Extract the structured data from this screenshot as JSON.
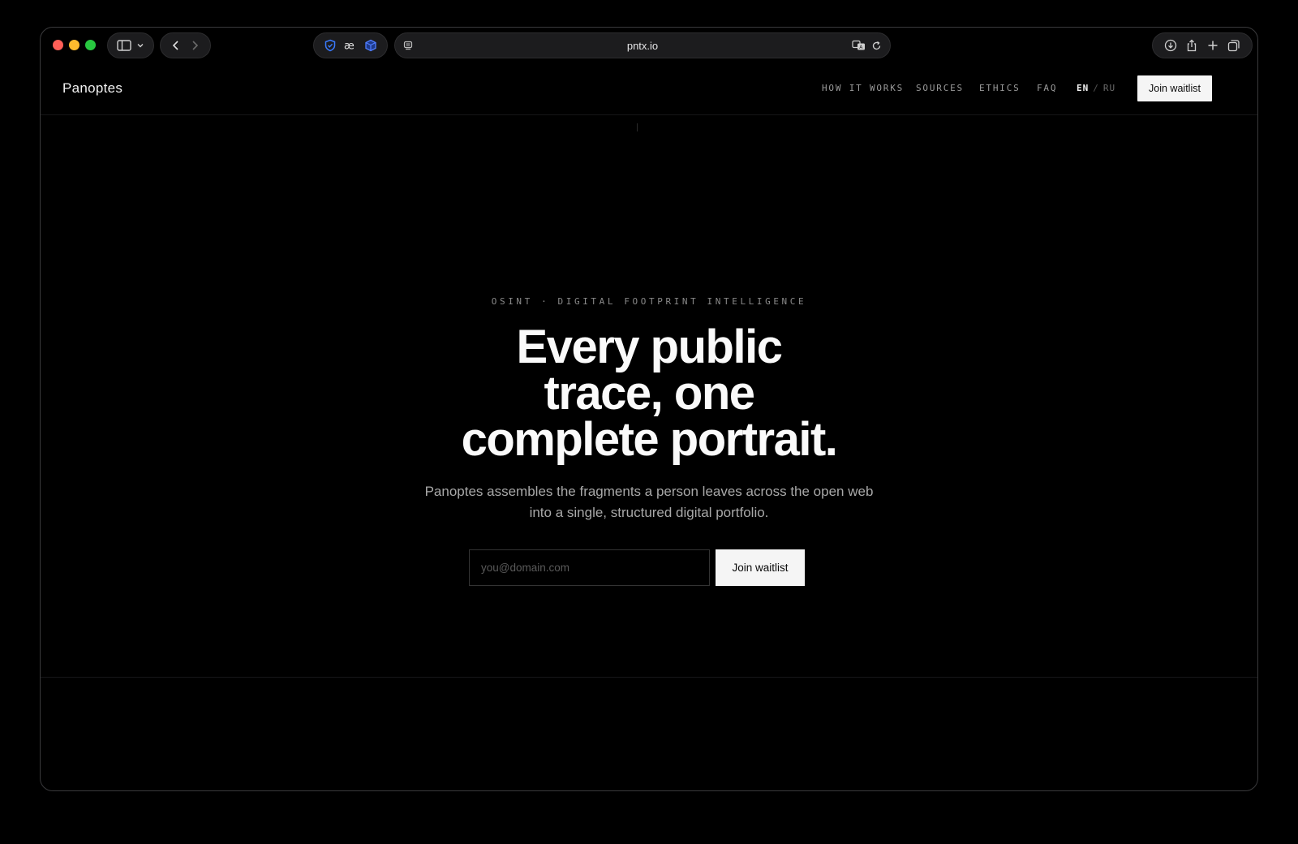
{
  "browser": {
    "url": "pntx.io"
  },
  "site": {
    "logo": "Panoptes",
    "nav": [
      {
        "label": "HOW IT WORKS"
      },
      {
        "label": "SOURCES"
      },
      {
        "label": "ETHICS"
      },
      {
        "label": "FAQ"
      }
    ],
    "lang": {
      "active": "EN",
      "separator": "/",
      "inactive": "RU"
    },
    "header_cta": "Join waitlist"
  },
  "hero": {
    "eyebrow": "OSINT · DIGITAL FOOTPRINT INTELLIGENCE",
    "headline_lines": [
      "Every public",
      "trace, one",
      "complete portrait."
    ],
    "subhead_lines": [
      "Panoptes assembles the fragments a person leaves across the open web",
      "into a single, structured digital portfolio."
    ],
    "email_placeholder": "you@domain.com",
    "email_value": "",
    "cta": "Join waitlist"
  },
  "colors": {
    "background": "#000000",
    "button_bg": "#f5f5f5",
    "button_text": "#0a0a0a",
    "nav_text": "#9a9a9a"
  }
}
